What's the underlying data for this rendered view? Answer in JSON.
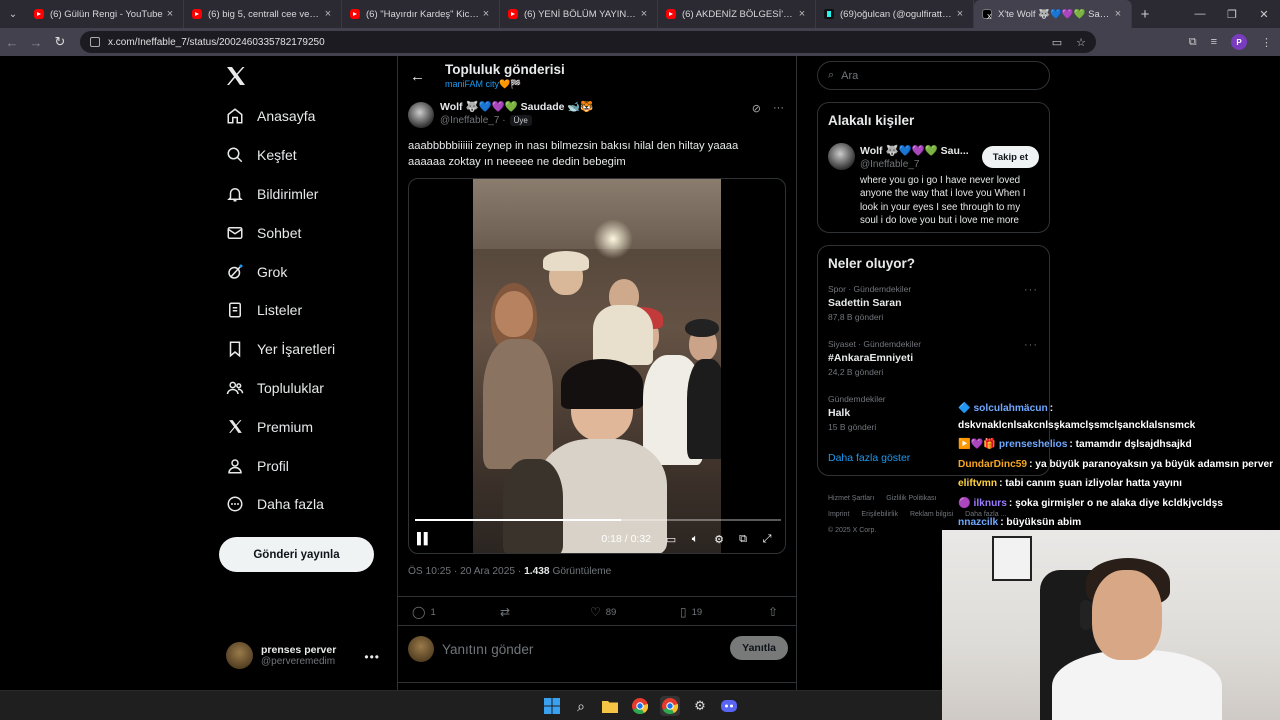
{
  "browser": {
    "tabs": [
      {
        "title": "(6) Gülün Rengi - YouTube",
        "type": "youtube"
      },
      {
        "title": "(6) big 5, centrall cee ve mançu",
        "type": "youtube"
      },
      {
        "title": "(6) \"Hayırdır Kardeş\" Kick & Tw",
        "type": "youtube"
      },
      {
        "title": "(6) YENİ BÖLÜM YAYINDA 🚨",
        "type": "youtube"
      },
      {
        "title": "(6) AKDENİZ BÖLGESİ'NİN EN",
        "type": "youtube"
      },
      {
        "title": "(69)oğulcan (@ogulfiratt) | Tik",
        "type": "tiktok"
      },
      {
        "title": "X'te Wolf 🐺💙💜💚 Saudade",
        "type": "x",
        "active": true
      }
    ],
    "url": "x.com/Ineffable_7/status/2002460335782179250"
  },
  "nav": {
    "items": [
      {
        "label": "Anasayfa",
        "icon": "home-icon"
      },
      {
        "label": "Keşfet",
        "icon": "search-icon"
      },
      {
        "label": "Bildirimler",
        "icon": "bell-icon"
      },
      {
        "label": "Sohbet",
        "icon": "mail-icon"
      },
      {
        "label": "Grok",
        "icon": "grok-icon"
      },
      {
        "label": "Listeler",
        "icon": "list-icon"
      },
      {
        "label": "Yer İşaretleri",
        "icon": "bookmark-icon"
      },
      {
        "label": "Topluluklar",
        "icon": "communities-icon"
      },
      {
        "label": "Premium",
        "icon": "x-icon"
      },
      {
        "label": "Profil",
        "icon": "profile-icon"
      },
      {
        "label": "Daha fazla",
        "icon": "more-icon"
      }
    ],
    "post_button": "Gönderi yayınla",
    "me": {
      "name": "prenses perver",
      "handle": "@perveremedim"
    }
  },
  "post": {
    "header_title": "Topluluk gönderisi",
    "header_sub": "maniFAM city🧡🏁",
    "author_name": "Wolf 🐺💙💜💚 Saudade 🐋🐯",
    "author_handle": "@Ineffable_7 ·",
    "member_badge": "Üye",
    "text": "aaabbbbbiiiiii zeynep in nası bilmezsin bakısı hilal den hiltay yaaaa aaaaaa zoktay ın neeeee ne dedin bebegim",
    "video": {
      "current": "0:18",
      "total": "0:32",
      "time_display": "0:18 / 0:32",
      "progress": 0.5625
    },
    "timestamp": "ÖS 10:25 · 20 Ara 2025 · ",
    "views": "1.438",
    "views_label": " Görüntüleme",
    "replies": "1",
    "likes": "89",
    "bookmarks": "19",
    "reply_placeholder": "Yanıtını gönder",
    "reply_button": "Yanıtla"
  },
  "right": {
    "search_placeholder": "Ara",
    "related_title": "Alakalı kişiler",
    "related": {
      "name": "Wolf 🐺💙💜💚 Sau...",
      "handle": "@Ineffable_7",
      "bio": "where you go i go I have never loved anyone the way that i love you When I look in your eyes I see through to my soul i do love you but i love me more",
      "follow": "Takip et"
    },
    "trends_title": "Neler oluyor?",
    "trends": [
      {
        "context": "Spor · Gündemdekiler",
        "name": "Sadettin Saran",
        "posts": "87,8 B gönderi"
      },
      {
        "context": "Siyaset · Gündemdekiler",
        "name": "#AnkaraEmniyeti",
        "posts": "24,2 B gönderi"
      },
      {
        "context": "Gündemdekiler",
        "name": "Halk",
        "posts": "15 B gönderi"
      }
    ],
    "show_more": "Daha fazla göster",
    "footer": [
      "Hizmet Şartları",
      "Gizlilik Politikası",
      "Imprint",
      "Erişilebilirlik",
      "Reklam bilgisi",
      "Daha fazla ...",
      "© 2025 X Corp."
    ]
  },
  "chat": [
    {
      "user": "solculahmäcun",
      "prefix": "🔷 ",
      "msg": ":",
      "color": "#6fa8ff"
    },
    {
      "user": "",
      "prefix": "",
      "msg": "dskvnaklcnlsakcnlsşkamclşsmclşancklalsnsmck",
      "color": "#ffffff"
    },
    {
      "user": "prenseshelios",
      "prefix": "▶️💜🎁 ",
      "msg": ": tamamdır dşlsajdhsajkd",
      "color": "#6fa8ff"
    },
    {
      "user": "DundarDinc59",
      "prefix": "",
      "msg": ": ya büyük paranoyaksın ya büyük adamsın perver",
      "color": "#f6a623"
    },
    {
      "user": "eliftvmn",
      "prefix": "",
      "msg": ": tabi canım şuan izliyolar hatta yayını",
      "color": "#ffd23f"
    },
    {
      "user": "ilknurs",
      "prefix": "🟣 ",
      "msg": ": şoka girmişler o ne alaka diye kcldkjvcldşs",
      "color": "#9b7bff"
    },
    {
      "user": "nnazcilk",
      "prefix": "",
      "msg": ": büyüksün abim",
      "color": "#6fa8ff"
    }
  ]
}
